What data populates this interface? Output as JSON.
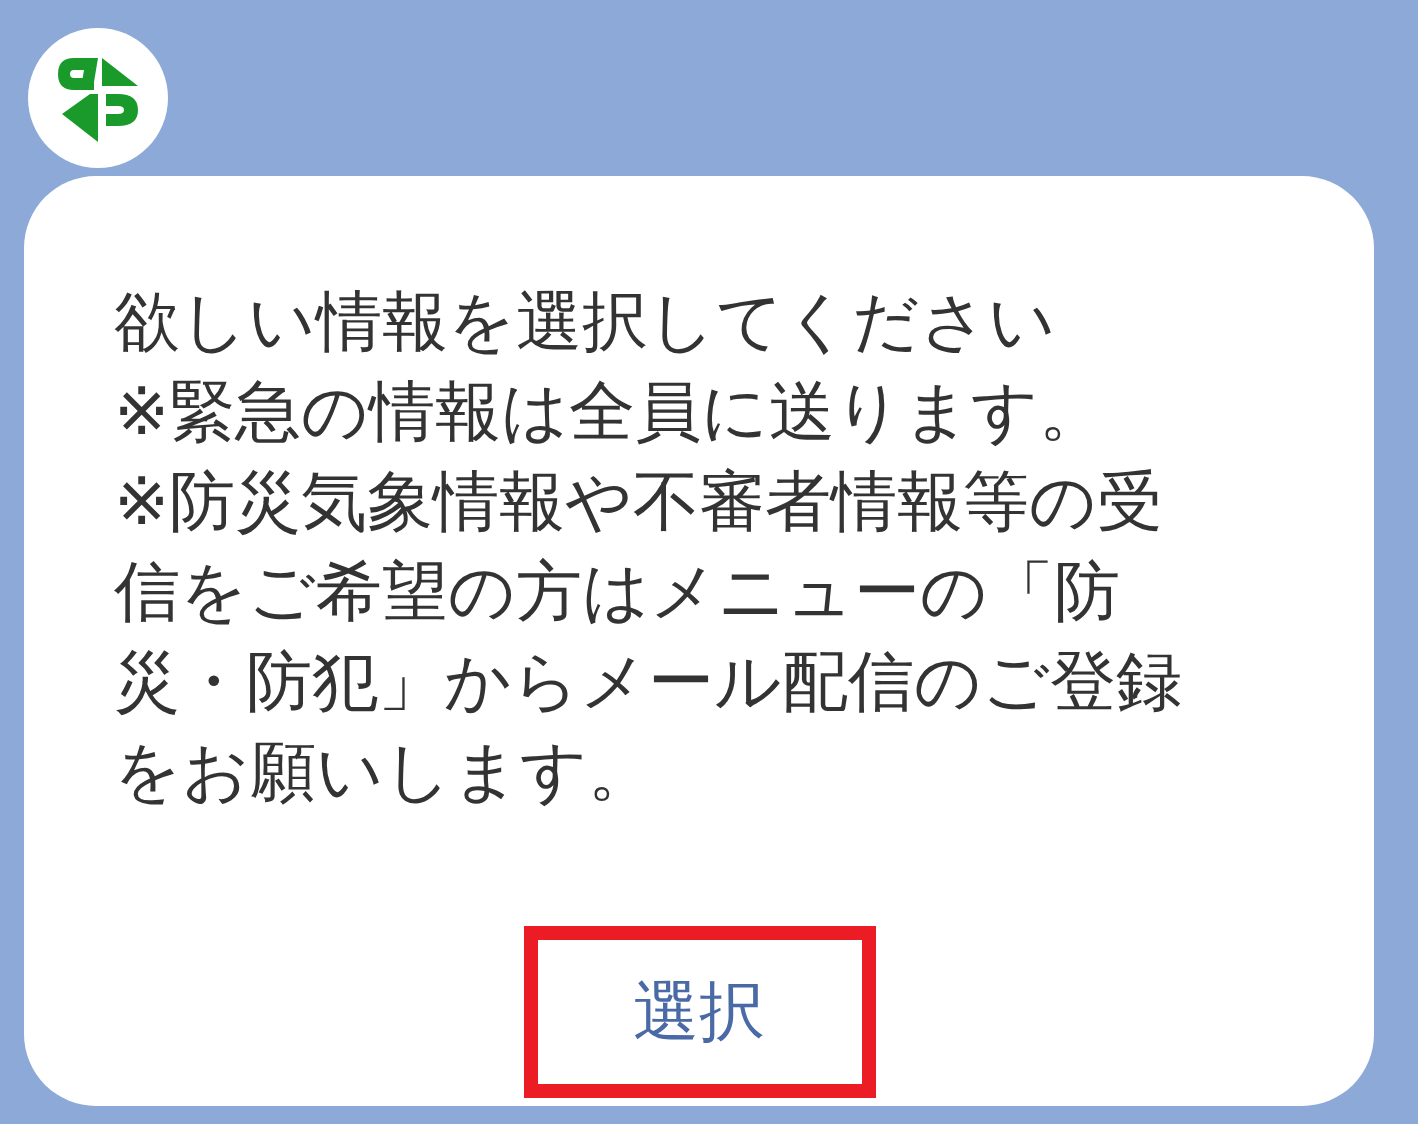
{
  "message": {
    "lines": [
      "欲しい情報を選択してください",
      "※緊急の情報は全員に送ります。",
      "※防災気象情報や不審者情報等の受",
      "信をご希望の方はメニューの「防",
      "災・防犯」からメール配信のご登録",
      "をお願いします。"
    ],
    "button": {
      "label": "選択",
      "highlighted": true
    }
  }
}
